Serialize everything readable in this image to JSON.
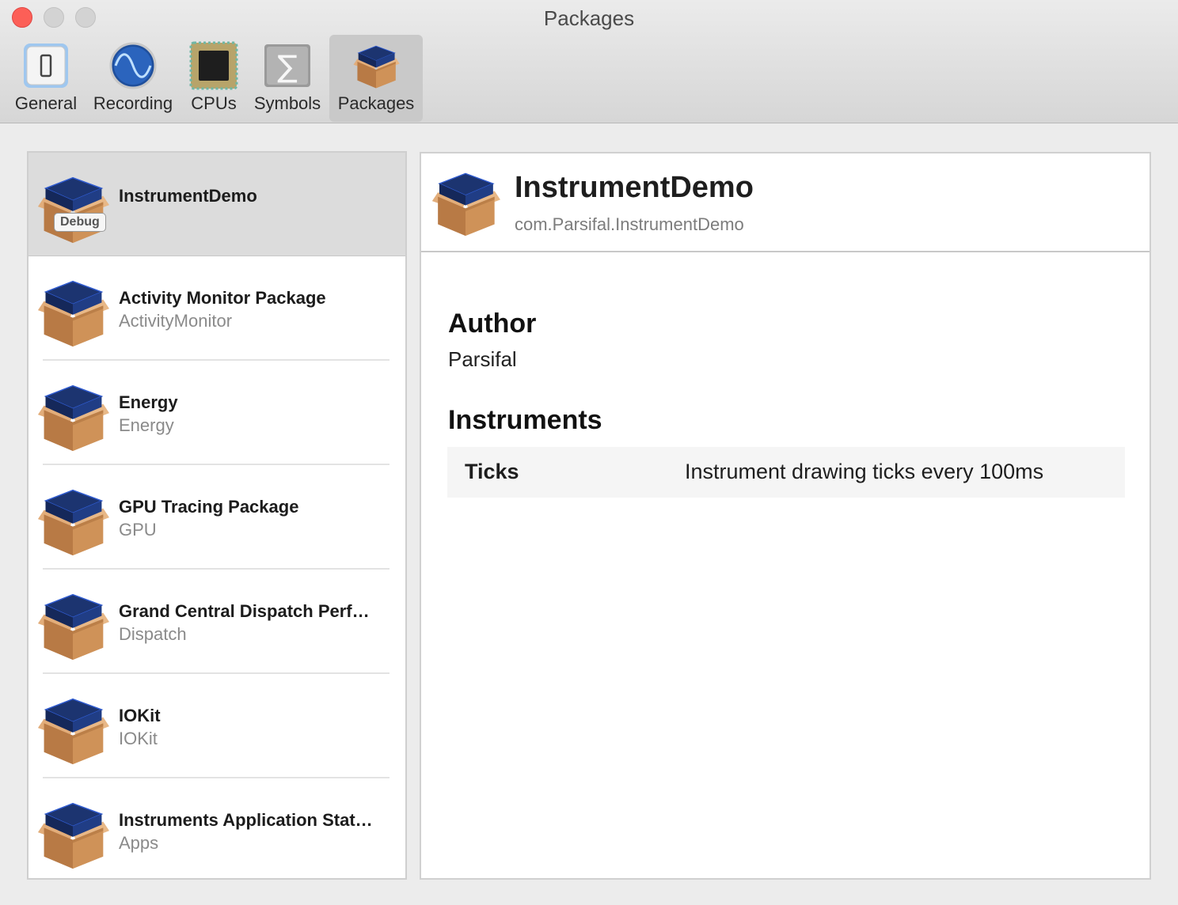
{
  "window": {
    "title": "Packages"
  },
  "toolbar": {
    "tabs": [
      {
        "label": "General",
        "icon": "general-icon"
      },
      {
        "label": "Recording",
        "icon": "recording-icon"
      },
      {
        "label": "CPUs",
        "icon": "cpus-icon"
      },
      {
        "label": "Symbols",
        "icon": "symbols-icon"
      },
      {
        "label": "Packages",
        "icon": "package-icon",
        "selected": true
      }
    ]
  },
  "packages": [
    {
      "title": "InstrumentDemo",
      "subtitle": "",
      "badge": "Debug",
      "selected": true
    },
    {
      "title": "Activity Monitor Package",
      "subtitle": "ActivityMonitor"
    },
    {
      "title": "Energy",
      "subtitle": "Energy"
    },
    {
      "title": "GPU Tracing Package",
      "subtitle": "GPU"
    },
    {
      "title": "Grand Central Dispatch Perf…",
      "subtitle": "Dispatch"
    },
    {
      "title": "IOKit",
      "subtitle": "IOKit"
    },
    {
      "title": "Instruments Application Stat…",
      "subtitle": "Apps"
    }
  ],
  "detail": {
    "title": "InstrumentDemo",
    "identifier": "com.Parsifal.InstrumentDemo",
    "author_heading": "Author",
    "author": "Parsifal",
    "instruments_heading": "Instruments",
    "instruments": [
      {
        "name": "Ticks",
        "description": "Instrument drawing ticks every 100ms"
      }
    ]
  },
  "colors": {
    "close_button": "#fc5f57",
    "selected_row": "#dcdcdc",
    "box_lid": "#1f3a78",
    "box_body": "#c98a4f"
  }
}
